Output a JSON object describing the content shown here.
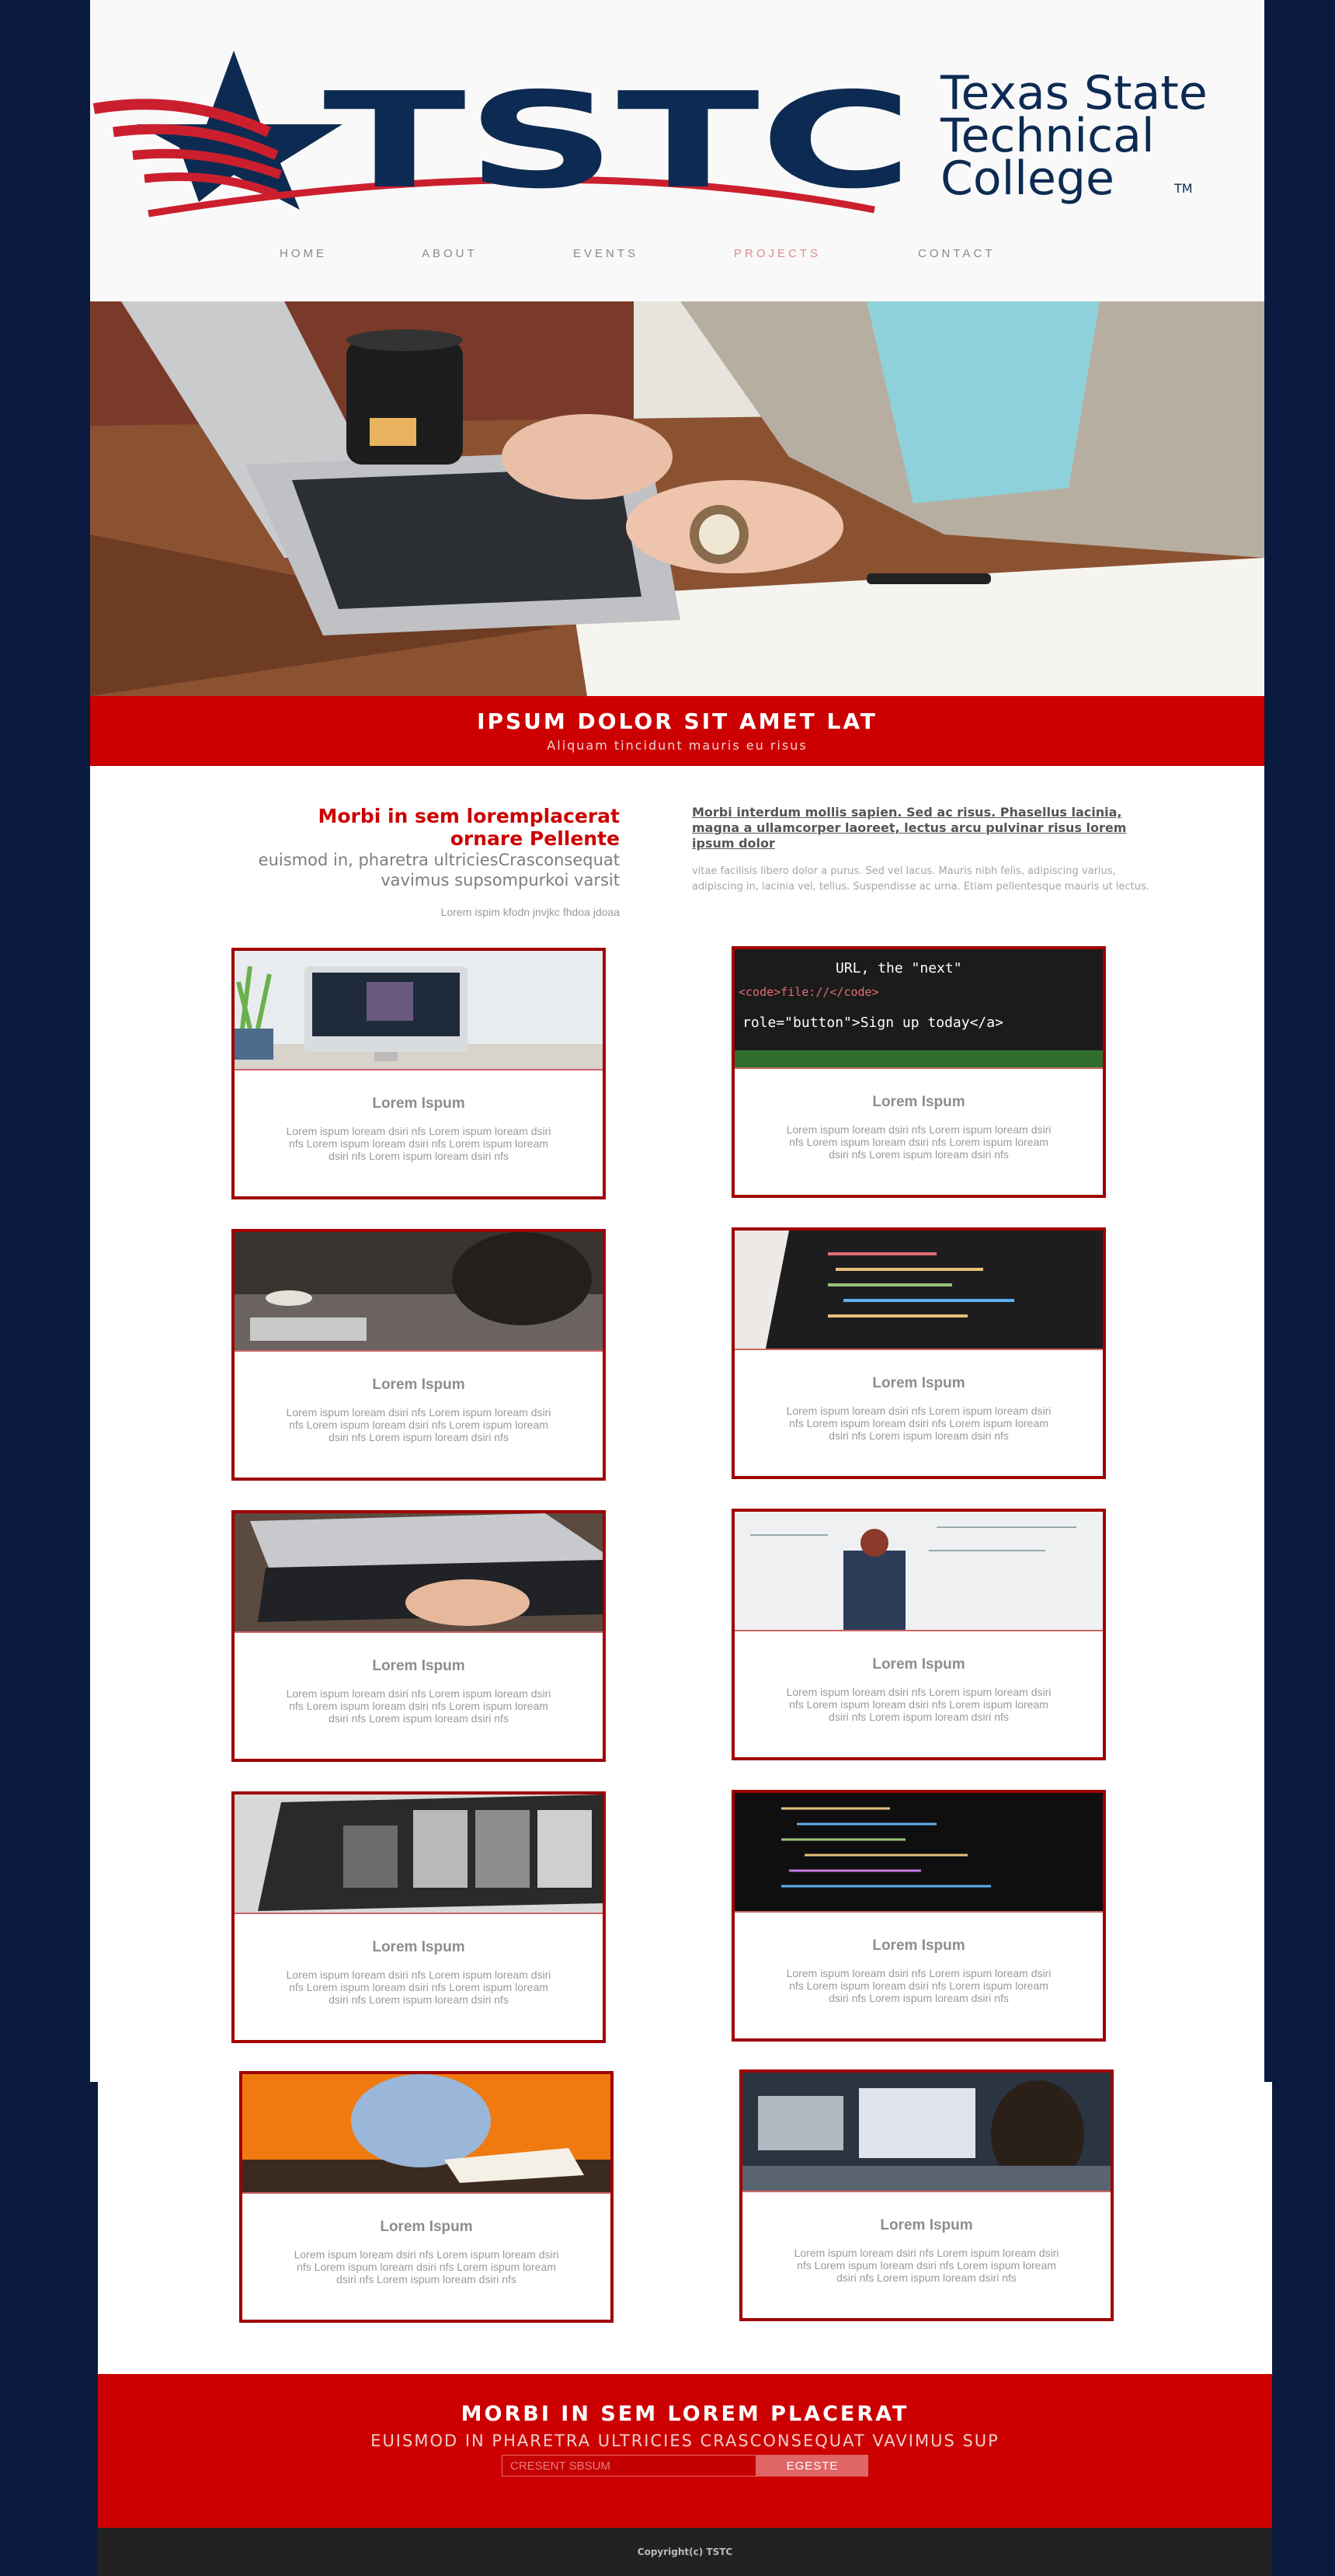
{
  "brand": {
    "logo_text": "TSTC",
    "college_line1": "Texas State",
    "college_line2": "Technical",
    "college_line3": "College",
    "trademark": "TM",
    "colors": {
      "navy": "#0d2b52",
      "red": "#cc1f2d"
    }
  },
  "nav": {
    "items": [
      {
        "label": "HOME"
      },
      {
        "label": "ABOUT"
      },
      {
        "label": "EVENTS"
      },
      {
        "label": "PROJECTS",
        "active": true
      },
      {
        "label": "CONTACT"
      }
    ]
  },
  "hero": {
    "image": "laptop-desk-photo"
  },
  "banner": {
    "title": "IPSUM DOLOR SIT AMET LAT",
    "subtitle": "Aliquam tincidunt mauris eu risus"
  },
  "intro": {
    "heading_line1": "Morbi in sem loremplacerat",
    "heading_line2": "ornare Pellente",
    "sub_line1": "euismod in, pharetra ultriciesCrasconsequat",
    "sub_line2": "vavimus supsompurkoi varsit",
    "small": "Lorem ispim kfodn jnvjkc fhdoa jdoaa",
    "link": "Morbi interdum mollis sapien. Sed ac risus. Phasellus lacinia, magna a ullamcorper laoreet, lectus arcu pulvinar risus lorem ipsum dolor",
    "body": "vitae facilisis libero dolor a purus. Sed vel lacus. Mauris nibh felis, adipiscing varius, adipiscing in, lacinia vel, tellus. Suspendisse ac urna. Etiam pellentesque mauris ut lectus."
  },
  "cards": [
    {
      "title": "Lorem Ispum",
      "text": "Lorem ispum loream dsiri nfs Lorem ispum loream dsiri nfs Lorem ispum loream dsiri nfs Lorem ispum loream dsiri nfs Lorem ispum loream dsiri nfs",
      "image": "desktop-computer-photo"
    },
    {
      "title": "Lorem Ispum",
      "text": "Lorem ispum loream dsiri nfs Lorem ispum loream dsiri nfs Lorem ispum loream dsiri nfs Lorem ispum loream dsiri nfs Lorem ispum loream dsiri nfs",
      "image": "code-closeup-photo"
    },
    {
      "title": "Lorem Ispum",
      "text": "Lorem ispum loream dsiri nfs Lorem ispum loream dsiri nfs Lorem ispum loream dsiri nfs Lorem ispum loream dsiri nfs Lorem ispum loream dsiri nfs",
      "image": "meeting-table-photo"
    },
    {
      "title": "Lorem Ispum",
      "text": "Lorem ispum loream dsiri nfs Lorem ispum loream dsiri nfs Lorem ispum loream dsiri nfs Lorem ispum loream dsiri nfs Lorem ispum loream dsiri nfs",
      "image": "code-monitor-photo"
    },
    {
      "title": "Lorem Ispum",
      "text": "Lorem ispum loream dsiri nfs Lorem ispum loream dsiri nfs Lorem ispum loream dsiri nfs Lorem ispum loream dsiri nfs Lorem ispum loream dsiri nfs",
      "image": "laptop-typing-photo"
    },
    {
      "title": "Lorem Ispum",
      "text": "Lorem ispum loream dsiri nfs Lorem ispum loream dsiri nfs Lorem ispum loream dsiri nfs Lorem ispum loream dsiri nfs Lorem ispum loream dsiri nfs",
      "image": "whiteboard-photo"
    },
    {
      "title": "Lorem Ispum",
      "text": "Lorem ispum loream dsiri nfs Lorem ispum loream dsiri nfs Lorem ispum loream dsiri nfs Lorem ispum loream dsiri nfs Lorem ispum loream dsiri nfs",
      "image": "laptop-screen-photo"
    },
    {
      "title": "Lorem Ispum",
      "text": "Lorem ispum loream dsiri nfs Lorem ispum loream dsiri nfs Lorem ispum loream dsiri nfs Lorem ispum loream dsiri nfs Lorem ispum loream dsiri nfs",
      "image": "dark-code-photo"
    },
    {
      "title": "Lorem Ispum",
      "text": "Lorem ispum loream dsiri nfs Lorem ispum loream dsiri nfs Lorem ispum loream dsiri nfs Lorem ispum loream dsiri nfs Lorem ispum loream dsiri nfs",
      "image": "man-writing-photo"
    },
    {
      "title": "Lorem Ispum",
      "text": "Lorem ispum loream dsiri nfs Lorem ispum loream dsiri nfs Lorem ispum loream dsiri nfs Lorem ispum loream dsiri nfs Lorem ispum loream dsiri nfs",
      "image": "woman-office-photo"
    }
  ],
  "subscribe": {
    "title": "MORBI IN SEM LOREM PLACERAT",
    "subtitle": "EUISMOD IN PHARETRA ULTRICIES CRASCONSEQUAT VAVIMUS SUP",
    "input_placeholder": "CRESENT SBSUM",
    "button_label": "EGESTE"
  },
  "footer": {
    "copyright": "Copyright(c) TSTC"
  }
}
